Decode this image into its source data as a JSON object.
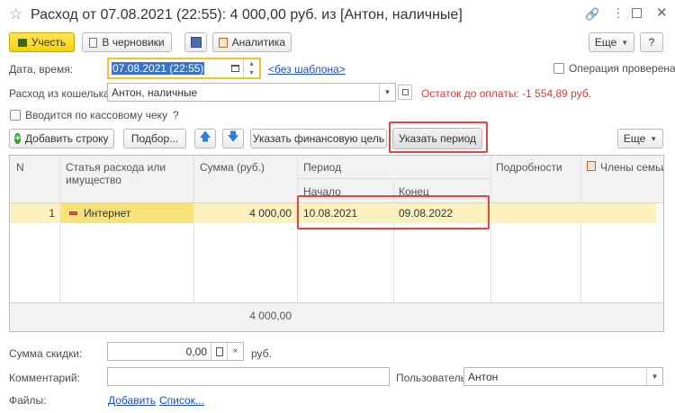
{
  "window": {
    "title": "Расход от 07.08.2021 (22:55): 4 000,00 руб. из [Антон,  наличные]",
    "controls": [
      "link-icon",
      "more-icon",
      "maximize-icon",
      "close-icon"
    ]
  },
  "toolbar": {
    "post_label": "Учесть",
    "draft_label": "В черновики",
    "analytics_label": "Аналитика",
    "more_label": "Еще",
    "help_label": "?"
  },
  "form": {
    "date_label": "Дата, время:",
    "date_value": "07.08.2021 (22:55)",
    "template_link": "<без шаблона>",
    "verified_label": "Операция проверена",
    "wallet_label": "Расход из кошелька:",
    "wallet_value": "Антон,  наличные",
    "balance_text": "Остаток до оплаты: -1 554,89 руб.",
    "receipt_label": "Вводится по кассовому чеку",
    "receipt_help": "?"
  },
  "table_toolbar": {
    "add_row_label": "Добавить строку",
    "pick_label": "Подбор...",
    "goal_label": "Указать финансовую цель",
    "period_label": "Указать период",
    "more_label": "Еще"
  },
  "table": {
    "headers": {
      "n": "N",
      "item": "Статья расхода или имущество",
      "sum": "Сумма (руб.)",
      "period": "Период",
      "start": "Начало",
      "end": "Конец",
      "details": "Подробности",
      "family": "Члены семьи"
    },
    "rows": [
      {
        "n": "1",
        "item": "Интернет",
        "sum": "4 000,00",
        "start": "10.08.2021",
        "end": "09.08.2022"
      }
    ],
    "total": "4 000,00"
  },
  "footer": {
    "discount_label": "Сумма скидки:",
    "discount_value": "0,00",
    "currency": "руб.",
    "comment_label": "Комментарий:",
    "comment_value": "",
    "user_label": "Пользователь:",
    "user_value": "Антон",
    "files_label": "Файлы:",
    "add_link": "Добавить",
    "list_link": "Список..."
  },
  "colors": {
    "accent_yellow": "#f5d20c",
    "selected_row": "#fbf2c0",
    "selected_cell": "#f7e27a",
    "highlight_red": "#e04545",
    "balance_red": "#d23c3c",
    "link_blue": "#1a4fbf"
  }
}
